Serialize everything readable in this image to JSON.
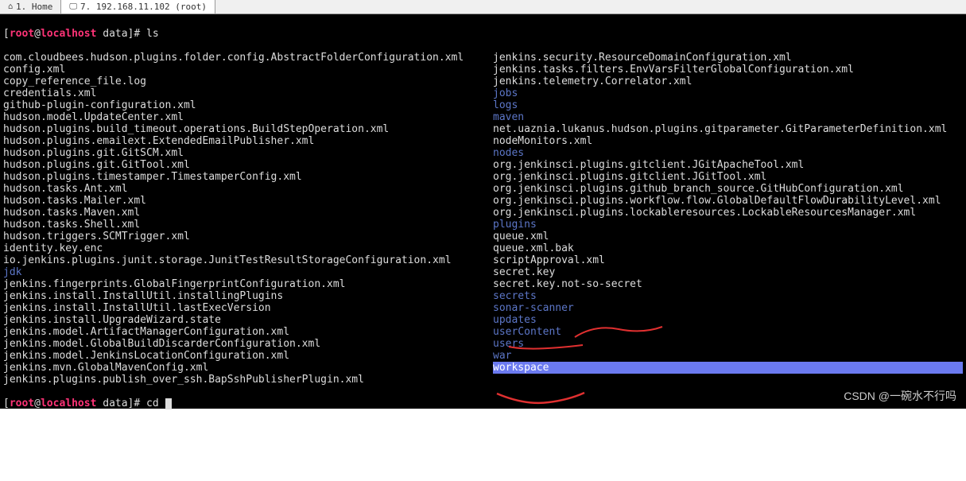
{
  "tabs": [
    {
      "icon": "⌂",
      "label": "1. Home"
    },
    {
      "icon": "🖵",
      "label": "7. 192.168.11.102 (root)"
    }
  ],
  "prompt1": {
    "user": "root",
    "at": "@",
    "host": "localhost",
    "path": " data]# ",
    "cmd": "ls"
  },
  "prompt2": {
    "user": "root",
    "at": "@",
    "host": "localhost",
    "path": " data]# ",
    "cmd": "cd "
  },
  "left": [
    {
      "t": "com.cloudbees.hudson.plugins.folder.config.AbstractFolderConfiguration.xml",
      "d": false
    },
    {
      "t": "config.xml",
      "d": false
    },
    {
      "t": "copy_reference_file.log",
      "d": false
    },
    {
      "t": "credentials.xml",
      "d": false
    },
    {
      "t": "github-plugin-configuration.xml",
      "d": false
    },
    {
      "t": "hudson.model.UpdateCenter.xml",
      "d": false
    },
    {
      "t": "hudson.plugins.build_timeout.operations.BuildStepOperation.xml",
      "d": false
    },
    {
      "t": "hudson.plugins.emailext.ExtendedEmailPublisher.xml",
      "d": false
    },
    {
      "t": "hudson.plugins.git.GitSCM.xml",
      "d": false
    },
    {
      "t": "hudson.plugins.git.GitTool.xml",
      "d": false
    },
    {
      "t": "hudson.plugins.timestamper.TimestamperConfig.xml",
      "d": false
    },
    {
      "t": "hudson.tasks.Ant.xml",
      "d": false
    },
    {
      "t": "hudson.tasks.Mailer.xml",
      "d": false
    },
    {
      "t": "hudson.tasks.Maven.xml",
      "d": false
    },
    {
      "t": "hudson.tasks.Shell.xml",
      "d": false
    },
    {
      "t": "hudson.triggers.SCMTrigger.xml",
      "d": false
    },
    {
      "t": "identity.key.enc",
      "d": false
    },
    {
      "t": "io.jenkins.plugins.junit.storage.JunitTestResultStorageConfiguration.xml",
      "d": false
    },
    {
      "t": "jdk",
      "d": true
    },
    {
      "t": "jenkins.fingerprints.GlobalFingerprintConfiguration.xml",
      "d": false
    },
    {
      "t": "jenkins.install.InstallUtil.installingPlugins",
      "d": false
    },
    {
      "t": "jenkins.install.InstallUtil.lastExecVersion",
      "d": false
    },
    {
      "t": "jenkins.install.UpgradeWizard.state",
      "d": false
    },
    {
      "t": "jenkins.model.ArtifactManagerConfiguration.xml",
      "d": false
    },
    {
      "t": "jenkins.model.GlobalBuildDiscarderConfiguration.xml",
      "d": false
    },
    {
      "t": "jenkins.model.JenkinsLocationConfiguration.xml",
      "d": false
    },
    {
      "t": "jenkins.mvn.GlobalMavenConfig.xml",
      "d": false
    },
    {
      "t": "jenkins.plugins.publish_over_ssh.BapSshPublisherPlugin.xml",
      "d": false
    }
  ],
  "right": [
    {
      "t": "jenkins.security.ResourceDomainConfiguration.xml",
      "d": false
    },
    {
      "t": "jenkins.tasks.filters.EnvVarsFilterGlobalConfiguration.xml",
      "d": false
    },
    {
      "t": "jenkins.telemetry.Correlator.xml",
      "d": false
    },
    {
      "t": "jobs",
      "d": true
    },
    {
      "t": "logs",
      "d": true
    },
    {
      "t": "maven",
      "d": true
    },
    {
      "t": "net.uaznia.lukanus.hudson.plugins.gitparameter.GitParameterDefinition.xml",
      "d": false
    },
    {
      "t": "nodeMonitors.xml",
      "d": false
    },
    {
      "t": "nodes",
      "d": true
    },
    {
      "t": "org.jenkinsci.plugins.gitclient.JGitApacheTool.xml",
      "d": false
    },
    {
      "t": "org.jenkinsci.plugins.gitclient.JGitTool.xml",
      "d": false
    },
    {
      "t": "org.jenkinsci.plugins.github_branch_source.GitHubConfiguration.xml",
      "d": false
    },
    {
      "t": "org.jenkinsci.plugins.workflow.flow.GlobalDefaultFlowDurabilityLevel.xml",
      "d": false
    },
    {
      "t": "org.jenkinsci.plugins.lockableresources.LockableResourcesManager.xml",
      "d": false
    },
    {
      "t": "plugins",
      "d": true
    },
    {
      "t": "queue.xml",
      "d": false
    },
    {
      "t": "queue.xml.bak",
      "d": false
    },
    {
      "t": "scriptApproval.xml",
      "d": false
    },
    {
      "t": "secret.key",
      "d": false
    },
    {
      "t": "secret.key.not-so-secret",
      "d": false
    },
    {
      "t": "secrets",
      "d": true
    },
    {
      "t": "sonar-scanner",
      "d": true
    },
    {
      "t": "updates",
      "d": true
    },
    {
      "t": "userContent",
      "d": true
    },
    {
      "t": "users",
      "d": true
    },
    {
      "t": "war",
      "d": true
    },
    {
      "t": "workspace",
      "d": true,
      "hl": true
    }
  ],
  "watermark": "CSDN @一碗水不行吗"
}
